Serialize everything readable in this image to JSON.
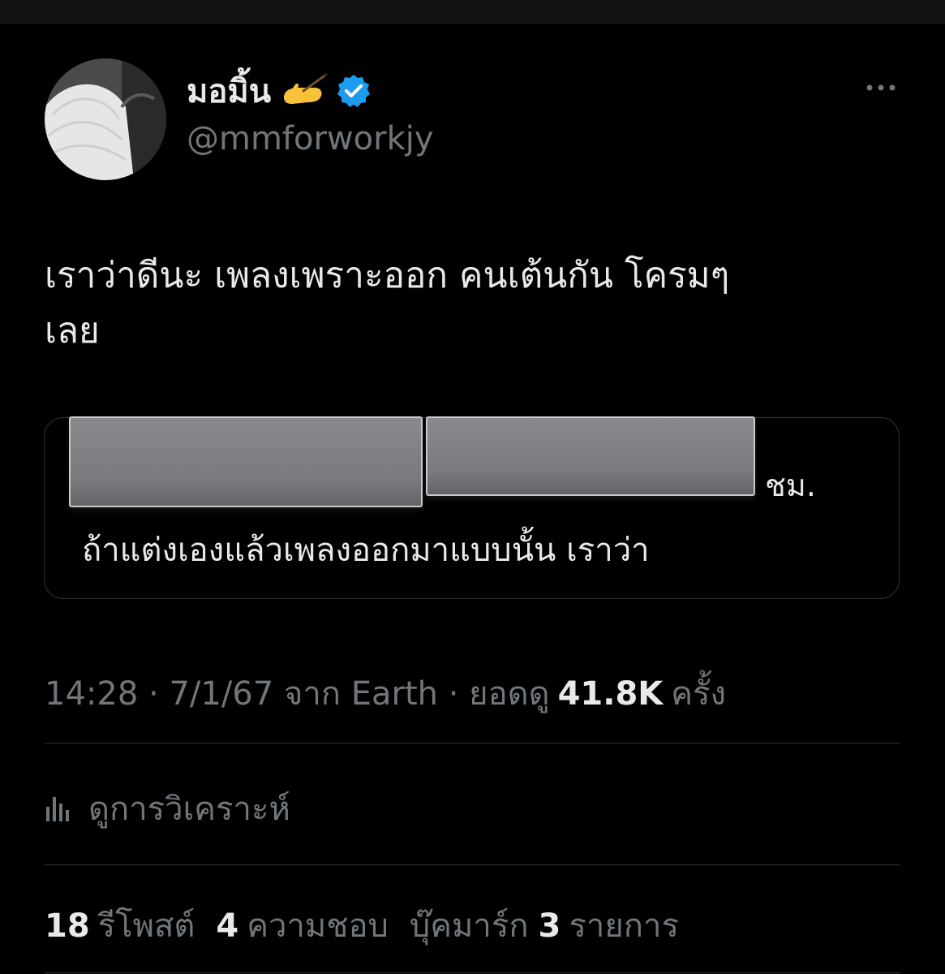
{
  "author": {
    "display_name": "มอมิ้น",
    "emoji": "writing-hand-emoji",
    "verified": true,
    "handle": "@mmforworkjy"
  },
  "tweet": {
    "text_lines": [
      "เราว่าดีนะ เพลงเพราะออก คนเต้นกัน โครมๆ",
      "เลย"
    ]
  },
  "quote": {
    "visible_fragment": "ชม.",
    "text": "ถ้าแต่งเองแล้วเพลงออกมาแบบนั้น เราว่า"
  },
  "meta": {
    "time": "14:28",
    "date": "7/1/67",
    "source": "จาก Earth",
    "views_label": "ยอดดู",
    "views_count": "41.8K",
    "views_unit": "ครั้ง"
  },
  "analytics": {
    "label": "ดูการวิเคราะห์"
  },
  "stats": {
    "reposts_count": "18",
    "reposts_label": "รีโพสต์",
    "likes_count": "4",
    "likes_label": "ความชอบ",
    "bookmarks_label": "บุ๊คมาร์ก",
    "bookmarks_count": "3",
    "bookmarks_unit": "รายการ"
  },
  "colors": {
    "background": "#000000",
    "text_primary": "#e7e9ea",
    "text_secondary": "#71767b",
    "verified_blue": "#1d9bf0",
    "border": "#2f3336"
  }
}
